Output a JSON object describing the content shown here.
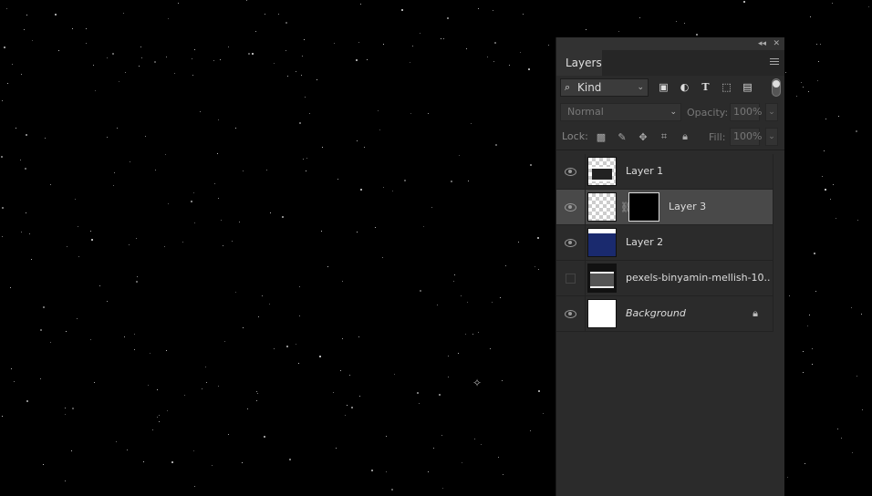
{
  "panel": {
    "tab_label": "Layers",
    "collapse_glyph": "◂◂",
    "close_glyph": "✕"
  },
  "filter": {
    "kind_label": "Kind",
    "icons": [
      "image-filter-icon",
      "adjustment-filter-icon",
      "type-filter-icon",
      "shape-filter-icon",
      "smart-object-filter-icon"
    ]
  },
  "blending": {
    "mode": "Normal",
    "opacity_label": "Opacity:",
    "opacity_value": "100%",
    "fill_label": "Fill:",
    "fill_value": "100%"
  },
  "lock": {
    "label": "Lock:"
  },
  "layers": [
    {
      "name": "Layer 1",
      "visible": true,
      "selected": false,
      "thumb": "transparent-art",
      "italic": false
    },
    {
      "name": "Layer 3",
      "visible": true,
      "selected": true,
      "thumb": "transparent",
      "has_mask": true,
      "italic": false
    },
    {
      "name": "Layer 2",
      "visible": true,
      "selected": false,
      "thumb": "blue",
      "italic": false
    },
    {
      "name": "pexels-binyamin-mellish-10...",
      "visible": false,
      "selected": false,
      "thumb": "photo",
      "italic": false
    },
    {
      "name": "Background",
      "visible": true,
      "selected": false,
      "thumb": "white",
      "italic": true,
      "locked": true
    }
  ]
}
